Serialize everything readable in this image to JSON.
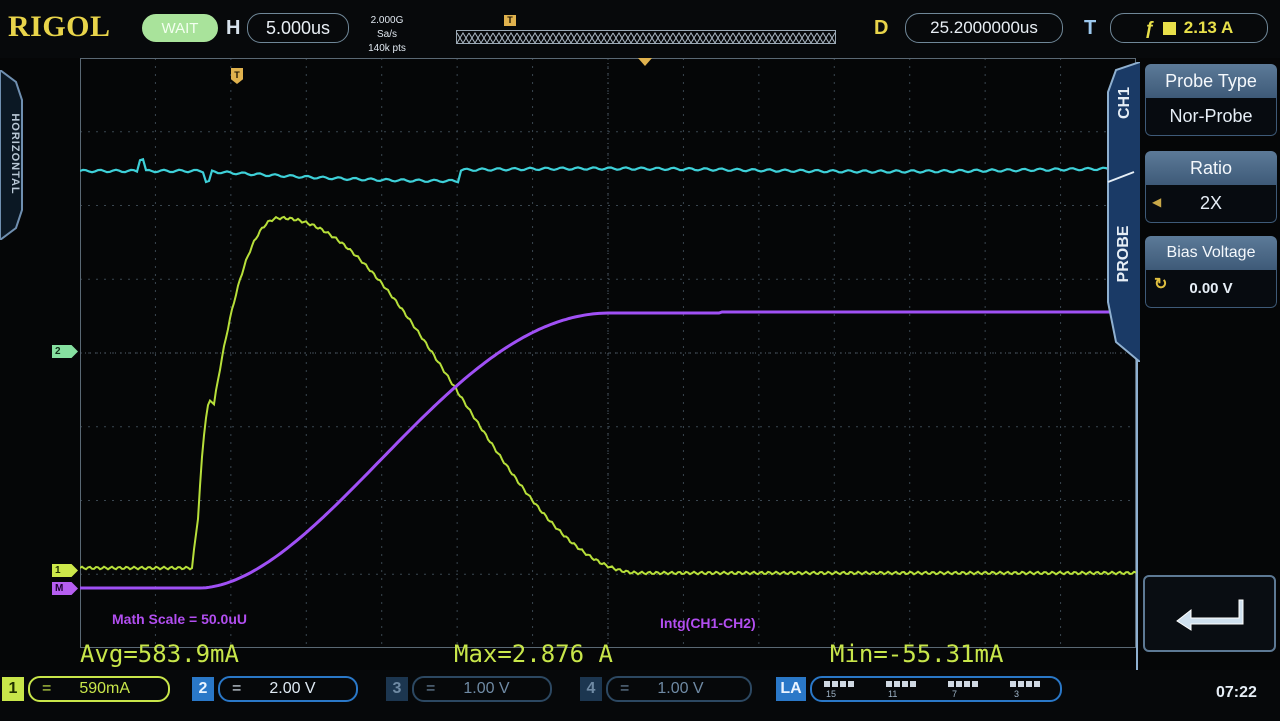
{
  "brand": "RIGOL",
  "status": "WAIT",
  "horizontal": {
    "label": "H",
    "timebase": "5.000us",
    "sample_rate": "2.000G Sa/s",
    "memory_depth": "140k pts",
    "side_tab": "HORIZONTAL"
  },
  "delay": {
    "label": "D",
    "value": "25.2000000us"
  },
  "trigger": {
    "label": "T",
    "level": "2.13 A",
    "edge_icon": "rising-edge-icon",
    "source_color": "#e8e04a"
  },
  "markers": {
    "ch2": "2",
    "ch1": "1",
    "math": "M",
    "trigger_pos": "T"
  },
  "annotations": {
    "math_scale": "Math Scale = 50.0uU",
    "math_func": "Intg(CH1-CH2)"
  },
  "measurements": {
    "avg": "Avg=583.9mA",
    "max": "Max=2.876 A",
    "min": "Min=-55.31mA"
  },
  "menu": {
    "channel": "CH1",
    "title": "PROBE",
    "items": [
      {
        "label": "Probe Type",
        "value": "Nor-Probe"
      },
      {
        "label": "Ratio",
        "value": "2X"
      },
      {
        "label": "Bias Voltage",
        "value": "0.00 V"
      }
    ],
    "enter_icon": "return-arrow-icon"
  },
  "channels": [
    {
      "num": "1",
      "coupling": "=",
      "scale": "590mA",
      "color": "#c8e64a"
    },
    {
      "num": "2",
      "coupling": "=",
      "scale": "2.00 V",
      "color": "#5fb0ea"
    },
    {
      "num": "3",
      "coupling": "=",
      "scale": "1.00 V",
      "color": "#3c5a78"
    },
    {
      "num": "4",
      "coupling": "=",
      "scale": "1.00 V",
      "color": "#3c5a78"
    }
  ],
  "logic_analyzer": {
    "label": "LA",
    "groups": [
      "15",
      "11",
      "7",
      "3"
    ]
  },
  "clock": "07:22",
  "colors": {
    "ch1": "#b7df3a",
    "ch2": "#3ed0d8",
    "math": "#a050f5",
    "grid": "#3a4650"
  }
}
